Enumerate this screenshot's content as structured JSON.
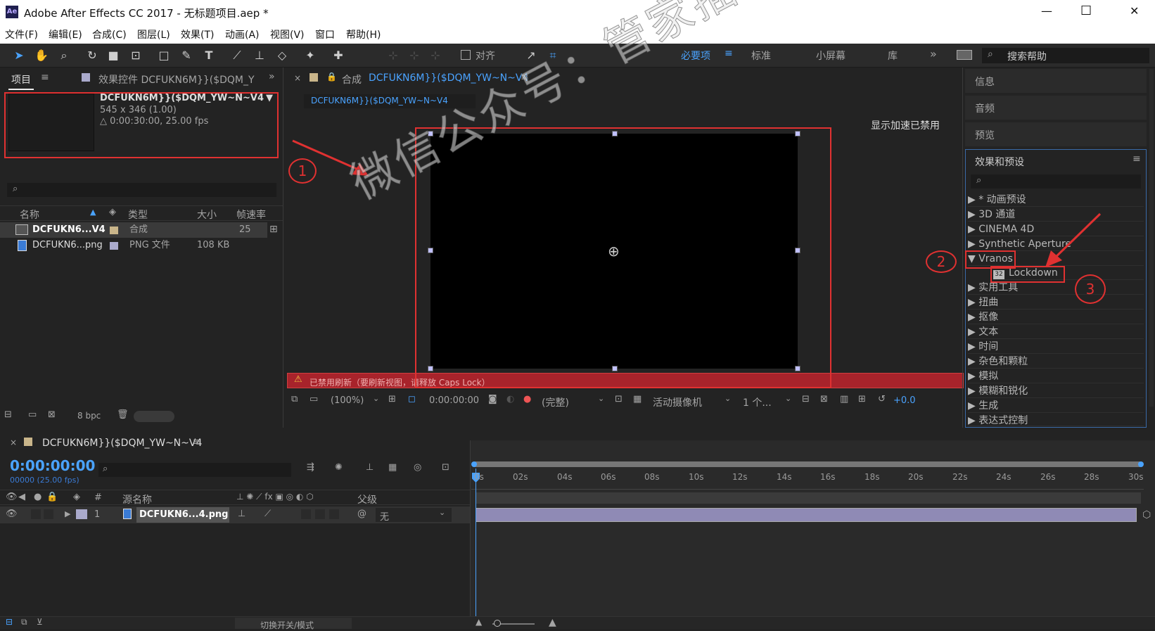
{
  "window": {
    "title": "Adobe After Effects CC 2017 - 无标题项目.aep *",
    "app_icon": "Ae",
    "minimize": "—",
    "maximize": "☐",
    "close": "✕"
  },
  "menu": [
    "文件(F)",
    "编辑(E)",
    "合成(C)",
    "图层(L)",
    "效果(T)",
    "动画(A)",
    "视图(V)",
    "窗口",
    "帮助(H)"
  ],
  "toolbar": {
    "align_label": "对齐",
    "workspaces": [
      "必要项",
      "标准",
      "小屏幕",
      "库"
    ],
    "search_help": "搜索帮助"
  },
  "project": {
    "tab_label": "项目",
    "effect_controls_label": "效果控件 DCFUKN6M}}($DQM_Y",
    "comp_name": "DCFUKN6M}}($DQM_YW~N~V4",
    "comp_size": "545 x 346 (1.00)",
    "comp_duration": "△ 0:00:30:00, 25.00 fps",
    "columns": [
      "名称",
      "类型",
      "大小",
      "帧速率"
    ],
    "rows": [
      {
        "name": "DCFUKN6...V4",
        "type": "合成",
        "size": "",
        "fps": "25"
      },
      {
        "name": "DCFUKN6...png",
        "type": "PNG 文件",
        "size": "108 KB",
        "fps": ""
      }
    ],
    "bpc": "8 bpc"
  },
  "composition": {
    "tab_label": "合成",
    "tab_name": "DCFUKN6M}}($DQM_YW~N~V4",
    "sub_tab": "DCFUKN6M}}($DQM_YW~N~V4",
    "accel_disabled": "显示加速已禁用",
    "warning": "已禁用刷新（要刷新视图，请释放 Caps Lock）",
    "zoom": "(100%)",
    "timecode": "0:00:00:00",
    "quality": "(完整)",
    "camera": "活动摄像机",
    "views": "1 个...",
    "exposure": "+0.0"
  },
  "right_panels": {
    "info": "信息",
    "audio": "音频",
    "preview": "预览",
    "effects_title": "效果和预设"
  },
  "effects": [
    "* 动画预设",
    "3D 通道",
    "CINEMA 4D",
    "Synthetic Aperture",
    "Vranos",
    "Lockdown",
    "实用工具",
    "扭曲",
    "抠像",
    "文本",
    "时间",
    "杂色和颗粒",
    "模拟",
    "模糊和锐化",
    "生成",
    "表达式控制"
  ],
  "timeline": {
    "tab_name": "DCFUKN6M}}($DQM_YW~N~V4",
    "timecode": "0:00:00:00",
    "frame_info": "00000 (25.00 fps)",
    "columns": {
      "num": "#",
      "source": "源名称",
      "parent": "父级"
    },
    "layer": {
      "num": "1",
      "name": "DCFUKN6...4.png",
      "parent": "无"
    },
    "ruler": [
      "0s",
      "02s",
      "04s",
      "06s",
      "08s",
      "10s",
      "12s",
      "14s",
      "16s",
      "18s",
      "20s",
      "22s",
      "24s",
      "26s",
      "28s",
      "30s"
    ],
    "footer": "切换开关/模式"
  },
  "annotations": {
    "n1": "1",
    "n2": "2",
    "n3": "3",
    "watermark": "微信公众号：管家插件"
  }
}
